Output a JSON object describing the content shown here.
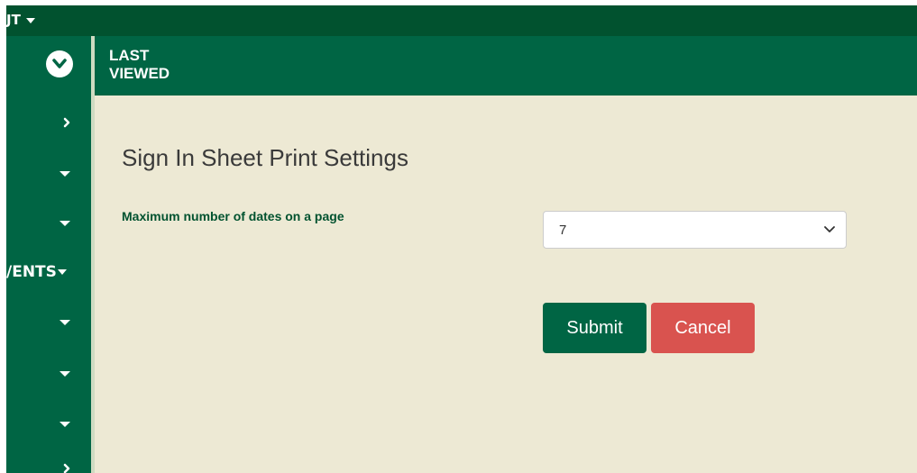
{
  "topbar": {
    "truncated_menu": "JT"
  },
  "sidebar": {
    "rows": [
      {
        "type": "chevron-right"
      },
      {
        "type": "caret"
      },
      {
        "type": "caret"
      },
      {
        "type": "label",
        "label": "/ENTS"
      },
      {
        "type": "caret"
      },
      {
        "type": "caret"
      },
      {
        "type": "caret"
      },
      {
        "type": "chevron-right"
      }
    ]
  },
  "header": {
    "title": "LAST VIEWED"
  },
  "form": {
    "title": "Sign In Sheet Print Settings",
    "max_dates_label": "Maximum number of dates on a page",
    "max_dates_value": "7",
    "submit_label": "Submit",
    "cancel_label": "Cancel"
  },
  "colors": {
    "topbar": "#01522f",
    "sidebar": "#006544",
    "content_bg": "#ede9d4",
    "submit": "#006544",
    "cancel": "#d9534f"
  }
}
